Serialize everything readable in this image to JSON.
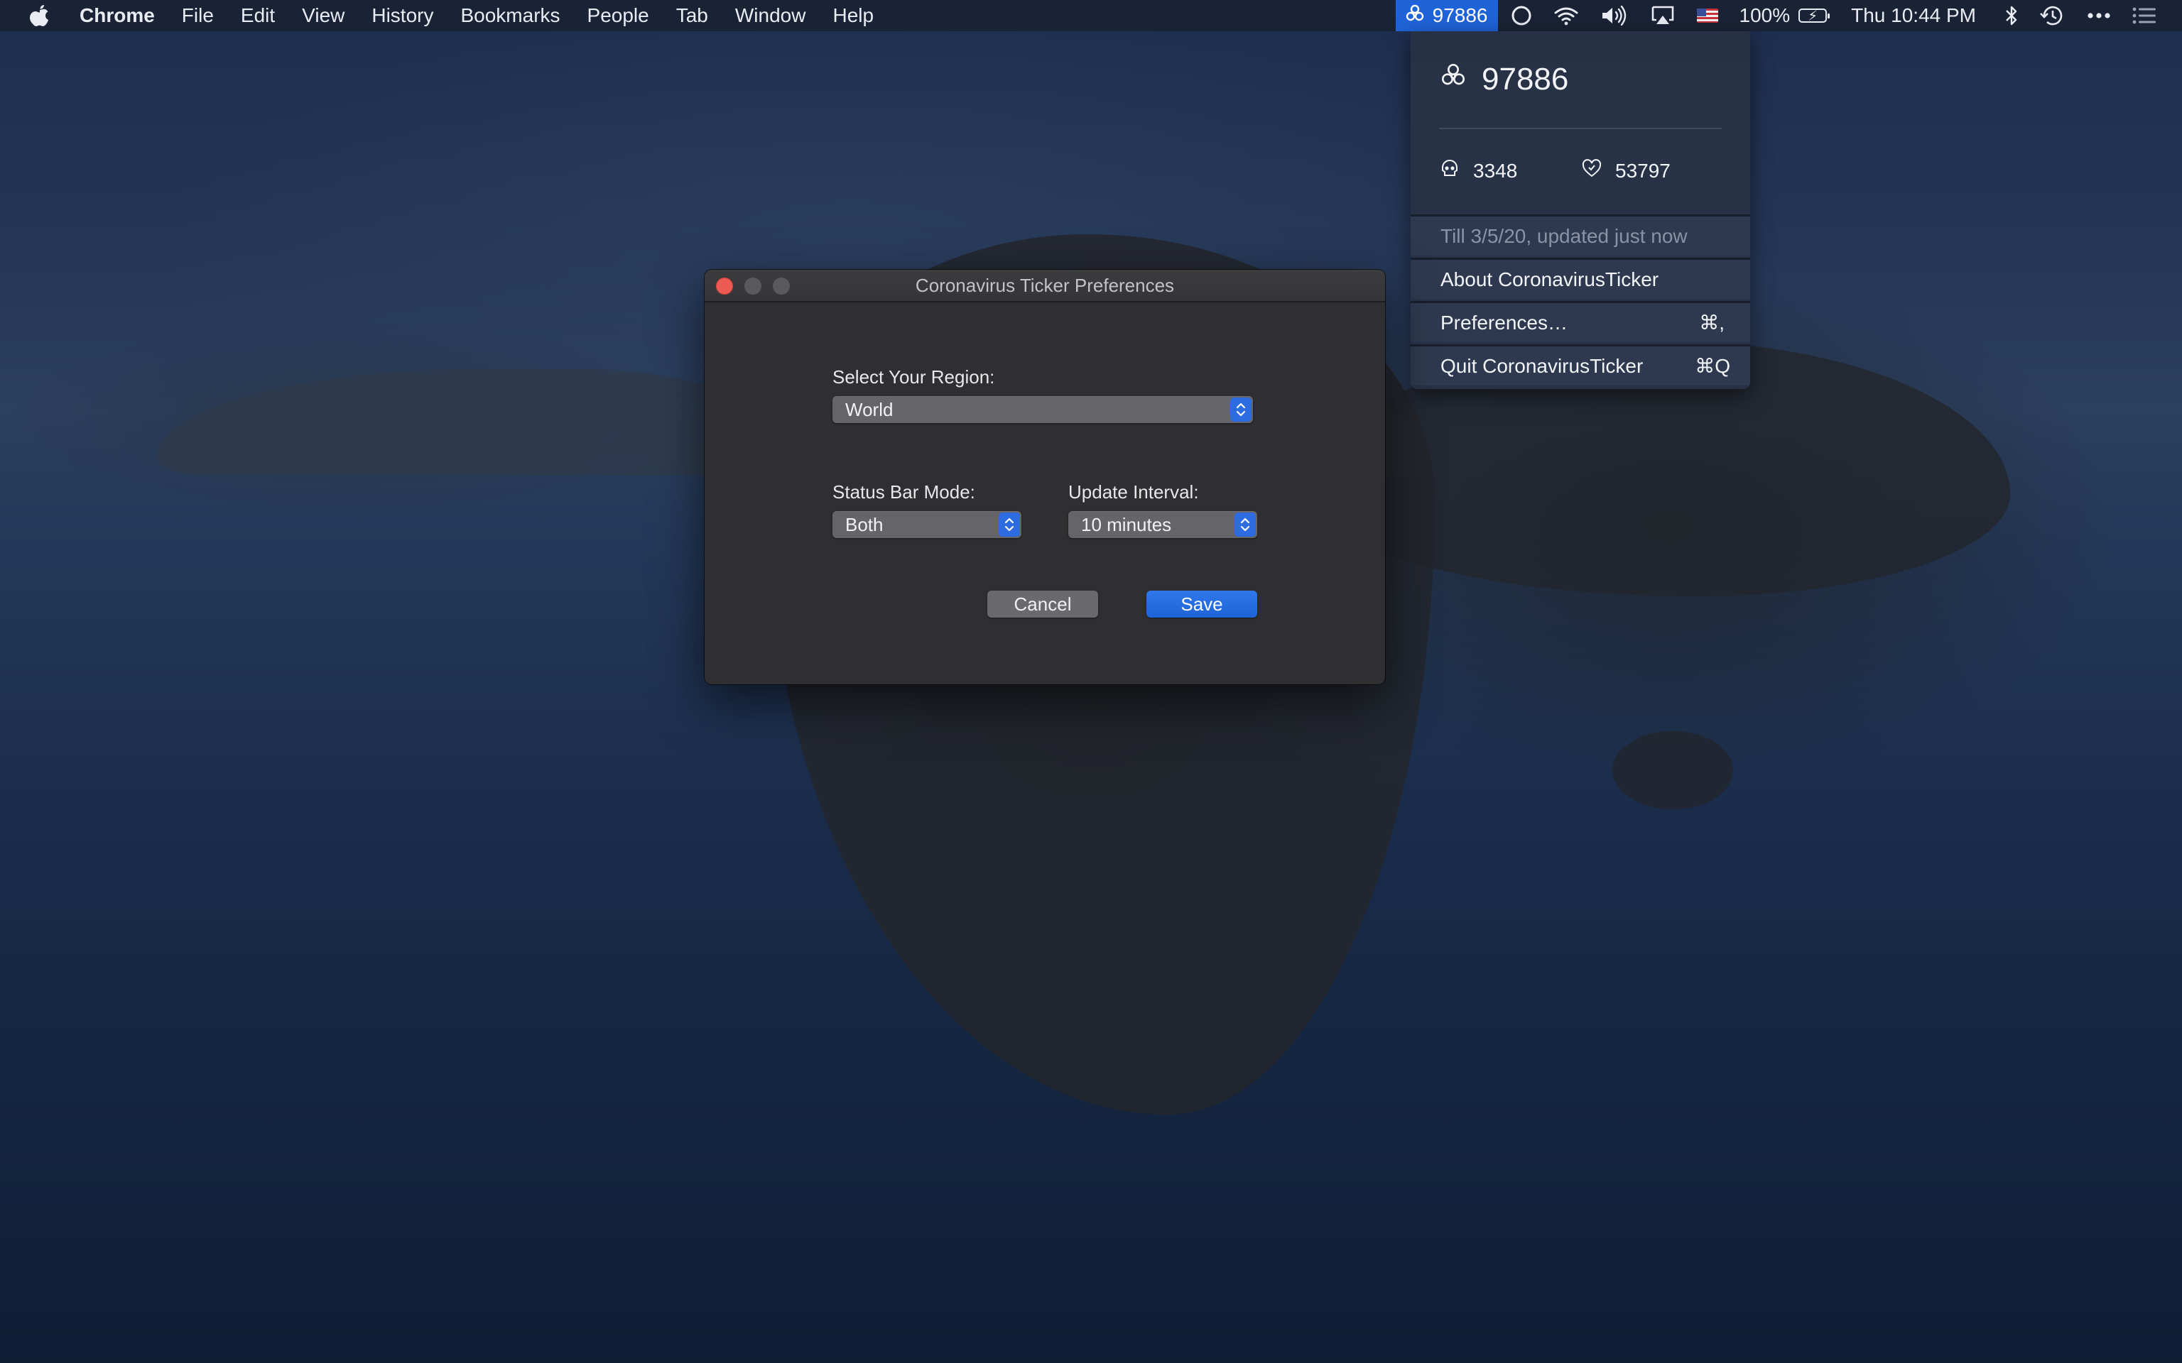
{
  "menubar": {
    "app_name": "Chrome",
    "items": [
      "File",
      "Edit",
      "View",
      "History",
      "Bookmarks",
      "People",
      "Tab",
      "Window",
      "Help"
    ],
    "ticker_count": "97886",
    "battery": "100%",
    "clock": "Thu 10:44 PM",
    "status_icons": [
      "biohazard-icon",
      "record-icon",
      "wifi-icon",
      "volume-icon",
      "airplay-icon",
      "us-flag-icon",
      "battery-icon",
      "bluetooth-icon",
      "time-machine-icon",
      "more-icon",
      "list-icon"
    ]
  },
  "dropdown": {
    "total": "97886",
    "deaths": "3348",
    "recovered": "53797",
    "updated": "Till 3/5/20, updated just now",
    "items": [
      {
        "label": "About CoronavirusTicker",
        "shortcut": ""
      },
      {
        "label": "Preferences…",
        "shortcut": "⌘,"
      },
      {
        "label": "Quit CoronavirusTicker",
        "shortcut": "⌘Q"
      }
    ]
  },
  "prefs": {
    "title": "Coronavirus Ticker Preferences",
    "region_label": "Select Your Region:",
    "region_value": "World",
    "mode_label": "Status Bar Mode:",
    "mode_value": "Both",
    "interval_label": "Update Interval:",
    "interval_value": "10 minutes",
    "cancel": "Cancel",
    "save": "Save"
  },
  "colors": {
    "accent": "#1f63d8",
    "close": "#ec5a52"
  }
}
